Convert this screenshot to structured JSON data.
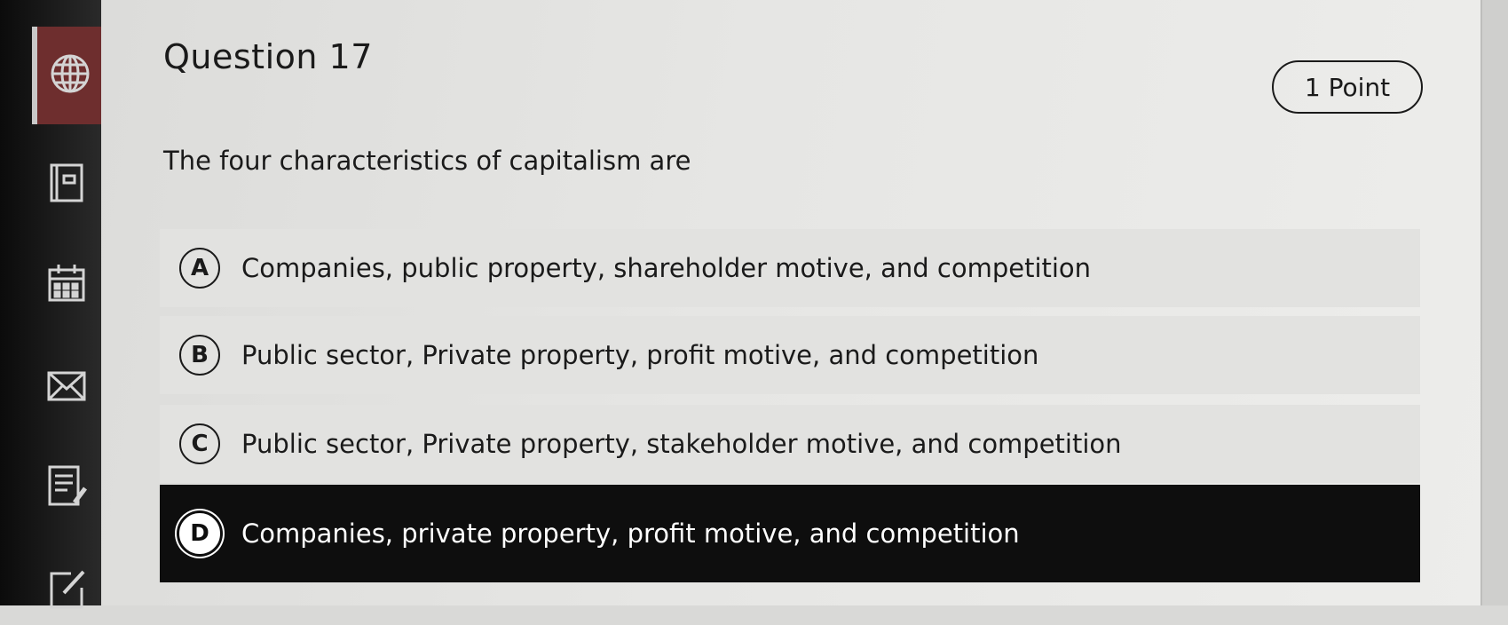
{
  "sidebar": {
    "items": [
      {
        "icon": "globe-icon",
        "active": true
      },
      {
        "icon": "notebook-icon",
        "active": false
      },
      {
        "icon": "calendar-icon",
        "active": false
      },
      {
        "icon": "mail-icon",
        "active": false
      },
      {
        "icon": "document-edit-icon",
        "active": false
      },
      {
        "icon": "edit-icon",
        "active": false
      }
    ]
  },
  "question": {
    "title": "Question 17",
    "points": "1 Point",
    "text": "The four characteristics of capitalism are",
    "options": [
      {
        "letter": "A",
        "label": "Companies, public property, shareholder motive, and competition",
        "selected": false
      },
      {
        "letter": "B",
        "label": "Public sector, Private property, profit motive, and competition",
        "selected": false
      },
      {
        "letter": "C",
        "label": "Public sector, Private property, stakeholder motive, and competition",
        "selected": false
      },
      {
        "letter": "D",
        "label": "Companies, private property, profit motive, and competition",
        "selected": true
      }
    ]
  },
  "colors": {
    "sidebar_active": "#6e2e2e",
    "selected_option_bg": "#0e0e0e",
    "option_bg": "#e2e2e0"
  }
}
